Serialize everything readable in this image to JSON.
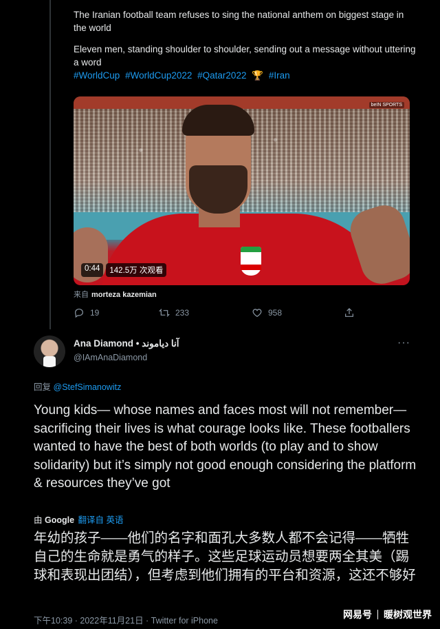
{
  "top_tweet": {
    "line1": "The Iranian football team refuses to sing the national anthem on biggest stage in the world",
    "line2": "Eleven men, standing shoulder to shoulder, sending out a message without uttering a word",
    "hashtags": [
      "#WorldCup",
      "#WorldCup2022",
      "#Qatar2022",
      "🏆",
      "#Iran"
    ],
    "video": {
      "duration": "0:44",
      "views": "142.5万 次观看",
      "broadcaster_tag": "beIN SPORTS"
    },
    "from_prefix": "来自",
    "from_user": "morteza kazemian",
    "stats": {
      "replies": "19",
      "retweets": "233",
      "likes": "958"
    }
  },
  "reply": {
    "name": "Ana Diamond • آنا دیاموند",
    "handle": "@IAmAnaDiamond",
    "replying_prefix": "回复",
    "replying_to": "@StefSimanowitz",
    "text": "Young kids— whose names and faces most will not remember— sacrificing their lives is what courage looks like. These footballers wanted to have the best of both worlds (to play and to show solidarity) but it’s simply not good enough considering the platform & resources they’ve got",
    "translate_prefix": "由",
    "translate_google": "Google",
    "translate_link": "翻译自 英语",
    "translated_text": "年幼的孩子——他们的名字和面孔大多数人都不会记得——牺牲自己的生命就是勇气的样子。这些足球运动员想要两全其美（踢球和表现出团结），但考虑到他们拥有的平台和资源，这还不够好",
    "timestamp": "下午10:39 · 2022年11月21日 · Twitter for iPhone"
  },
  "watermark": {
    "left": "网易号",
    "right": "暖树观世界"
  },
  "colors": {
    "background": "#000000",
    "link": "#1d9bf0",
    "muted": "#8b98a5"
  }
}
